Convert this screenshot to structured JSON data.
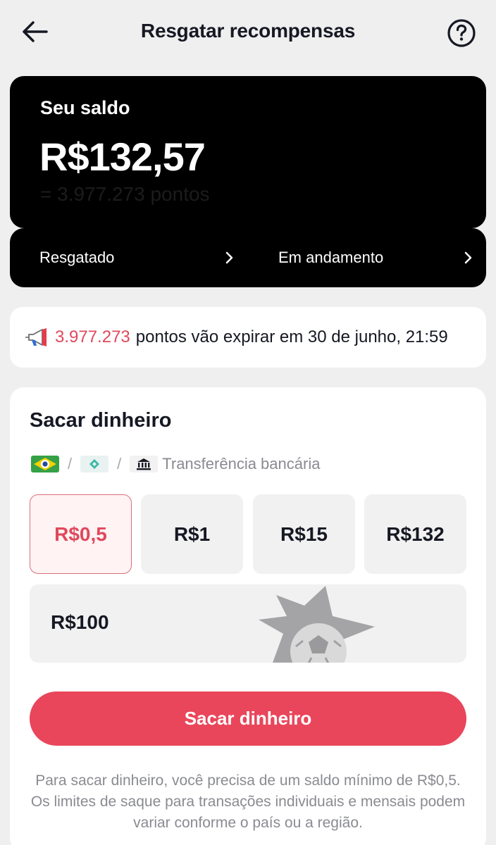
{
  "header": {
    "title": "Resgatar recompensas",
    "back_icon": "arrow-left-icon",
    "help_icon": "question-circle-icon"
  },
  "balance": {
    "label": "Seu saldo",
    "value": "R$132,57",
    "points": "= 3.977.273 pontos",
    "redeemed_label": "Resgatado",
    "in_progress_label": "Em andamento"
  },
  "notice": {
    "points": "3.977.273",
    "text": "pontos vão expirar em 30 de junho, 21:59",
    "accent": "#e0495c"
  },
  "cash": {
    "title": "Sacar dinheiro",
    "methods_sep": "/",
    "bank_label": "Transferência bancária",
    "amounts": [
      "R$0,5",
      "R$1",
      "R$15",
      "R$132"
    ],
    "amount_wide": "R$100",
    "selected_index": 0,
    "cta_label": "Sacar dinheiro",
    "cta_color": "#e9465b",
    "footnote": "Para sacar dinheiro, você precisa de um saldo mínimo de R$0,5. Os limites de saque para transações individuais e mensais podem variar conforme o país ou a região."
  }
}
